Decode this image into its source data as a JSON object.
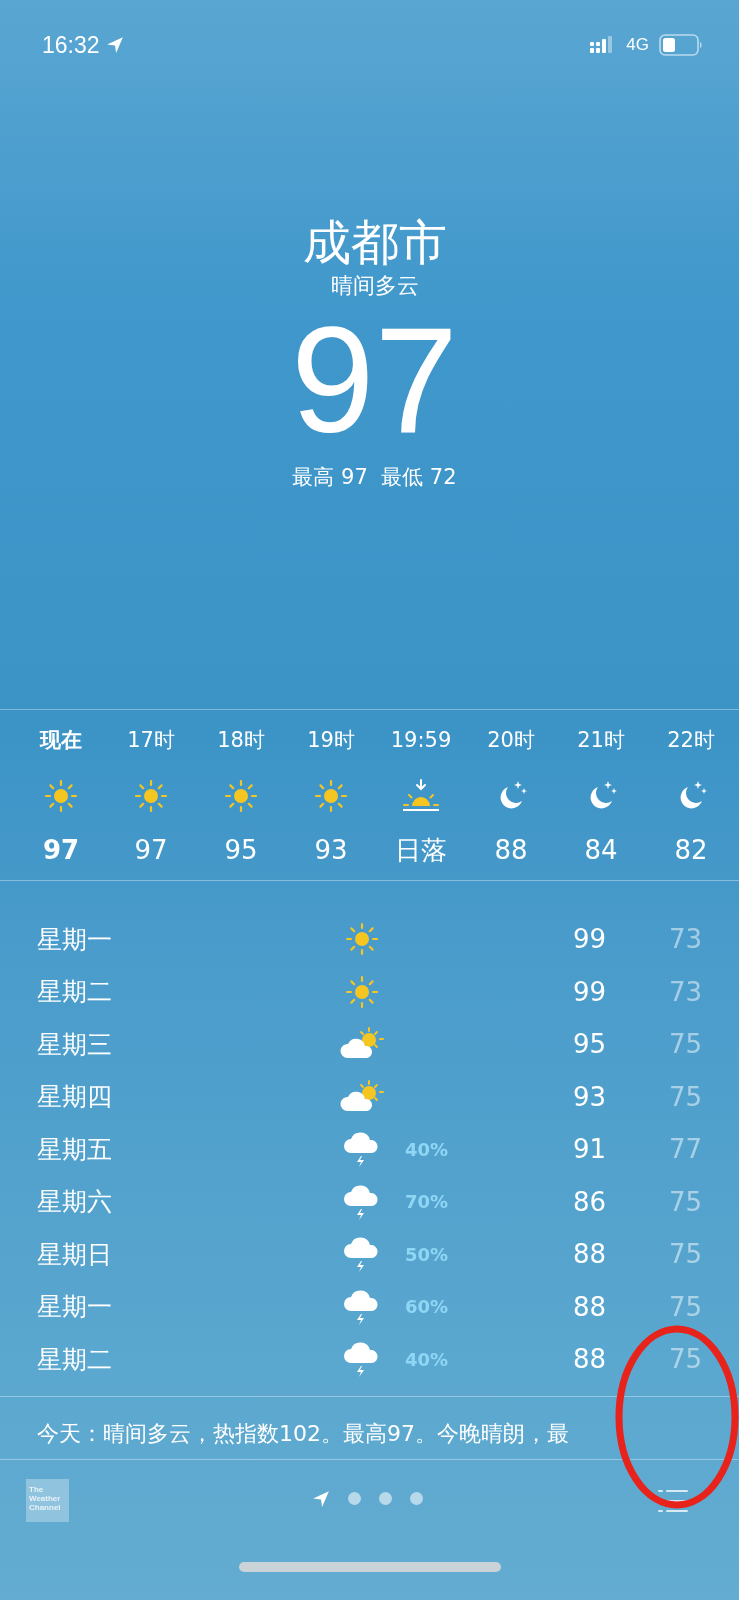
{
  "status_bar": {
    "time": "16:32",
    "network": "4G"
  },
  "header": {
    "city": "成都市",
    "condition": "晴间多云",
    "temperature": "97",
    "high_low": "最高 97  最低 72"
  },
  "hourly": [
    {
      "label": "现在",
      "kind": "sun",
      "temp": "97",
      "current": true
    },
    {
      "label": "17时",
      "kind": "sun",
      "temp": "97",
      "current": false
    },
    {
      "label": "18时",
      "kind": "sun",
      "temp": "95",
      "current": false
    },
    {
      "label": "19时",
      "kind": "sun",
      "temp": "93",
      "current": false
    },
    {
      "label": "19:59",
      "kind": "sunset",
      "temp": "日落",
      "current": false
    },
    {
      "label": "20时",
      "kind": "moon",
      "temp": "88",
      "current": false
    },
    {
      "label": "21时",
      "kind": "moon",
      "temp": "84",
      "current": false
    },
    {
      "label": "22时",
      "kind": "moon",
      "temp": "82",
      "current": false
    }
  ],
  "daily": [
    {
      "day": "星期一",
      "kind": "sun",
      "high": "99",
      "low": "73"
    },
    {
      "day": "星期二",
      "kind": "sun",
      "high": "99",
      "low": "73"
    },
    {
      "day": "星期三",
      "kind": "partly",
      "high": "95",
      "low": "75"
    },
    {
      "day": "星期四",
      "kind": "partly",
      "high": "93",
      "low": "75"
    },
    {
      "day": "星期五",
      "kind": "storm",
      "chance": "40%",
      "high": "91",
      "low": "77"
    },
    {
      "day": "星期六",
      "kind": "storm",
      "chance": "70%",
      "high": "86",
      "low": "75"
    },
    {
      "day": "星期日",
      "kind": "storm",
      "chance": "50%",
      "high": "88",
      "low": "75"
    },
    {
      "day": "星期一",
      "kind": "storm",
      "chance": "60%",
      "high": "88",
      "low": "75"
    },
    {
      "day": "星期二",
      "kind": "storm",
      "chance": "40%",
      "high": "88",
      "low": "75"
    }
  ],
  "summary": "今天：晴间多云，热指数102。最高97。今晚晴朗，最",
  "footer": {
    "logo": "The Weather Channel",
    "pages": [
      {
        "kind": "location",
        "selected": true
      },
      {
        "kind": "dot",
        "selected": false
      },
      {
        "kind": "dot",
        "selected": false
      },
      {
        "kind": "dot",
        "selected": false
      }
    ]
  }
}
